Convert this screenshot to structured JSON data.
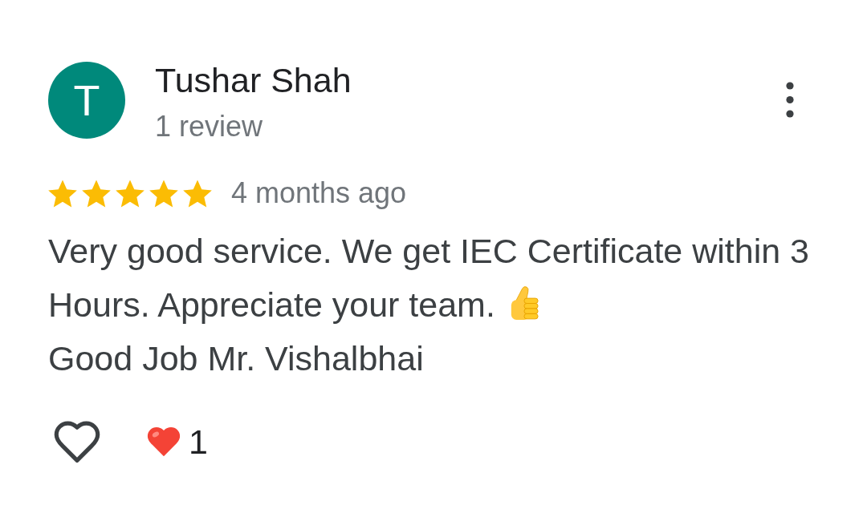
{
  "review": {
    "author": {
      "initial": "T",
      "name": "Tushar Shah",
      "review_count": "1 review"
    },
    "rating": {
      "stars": 5,
      "time": "4 months ago"
    },
    "body": [
      {
        "text": "Very good service. We get IEC Certificate within 3",
        "emoji": false
      },
      {
        "text": "Hours. Appreciate your team.",
        "emoji": true
      },
      {
        "text": "Good Job Mr. Vishalbhai",
        "emoji": false
      }
    ],
    "actions": {
      "liked": false,
      "reaction_count": "1"
    }
  }
}
